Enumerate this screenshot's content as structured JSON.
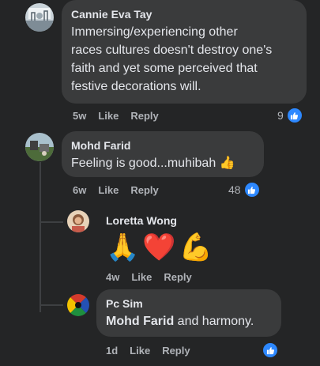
{
  "comments": [
    {
      "author": "Cannie Eva Tay",
      "text_lines": [
        "Immersing/experiencing other",
        "races cultures doesn't destroy one's",
        "faith and yet some perceived that",
        "festive decorations will."
      ],
      "time": "5w",
      "like_label": "Like",
      "reply_label": "Reply",
      "reaction_count": "9"
    },
    {
      "author": "Mohd Farid",
      "text": "Feeling is good...muhibah",
      "emoji": "👍",
      "time": "6w",
      "like_label": "Like",
      "reply_label": "Reply",
      "reaction_count": "48"
    }
  ],
  "replies": [
    {
      "author": "Loretta Wong",
      "emojis": [
        "🙏",
        "❤️",
        "💪"
      ],
      "time": "4w",
      "like_label": "Like",
      "reply_label": "Reply"
    },
    {
      "author": "Pc Sim",
      "mention": "Mohd Farid",
      "text": " and harmony.",
      "time": "1d",
      "like_label": "Like",
      "reply_label": "Reply"
    }
  ],
  "colors": {
    "background": "#242526",
    "bubble": "#3a3b3c",
    "like_blue": "#2d88ff",
    "muted": "#b0b3b8"
  },
  "icons": [
    "like-thumb-icon"
  ]
}
